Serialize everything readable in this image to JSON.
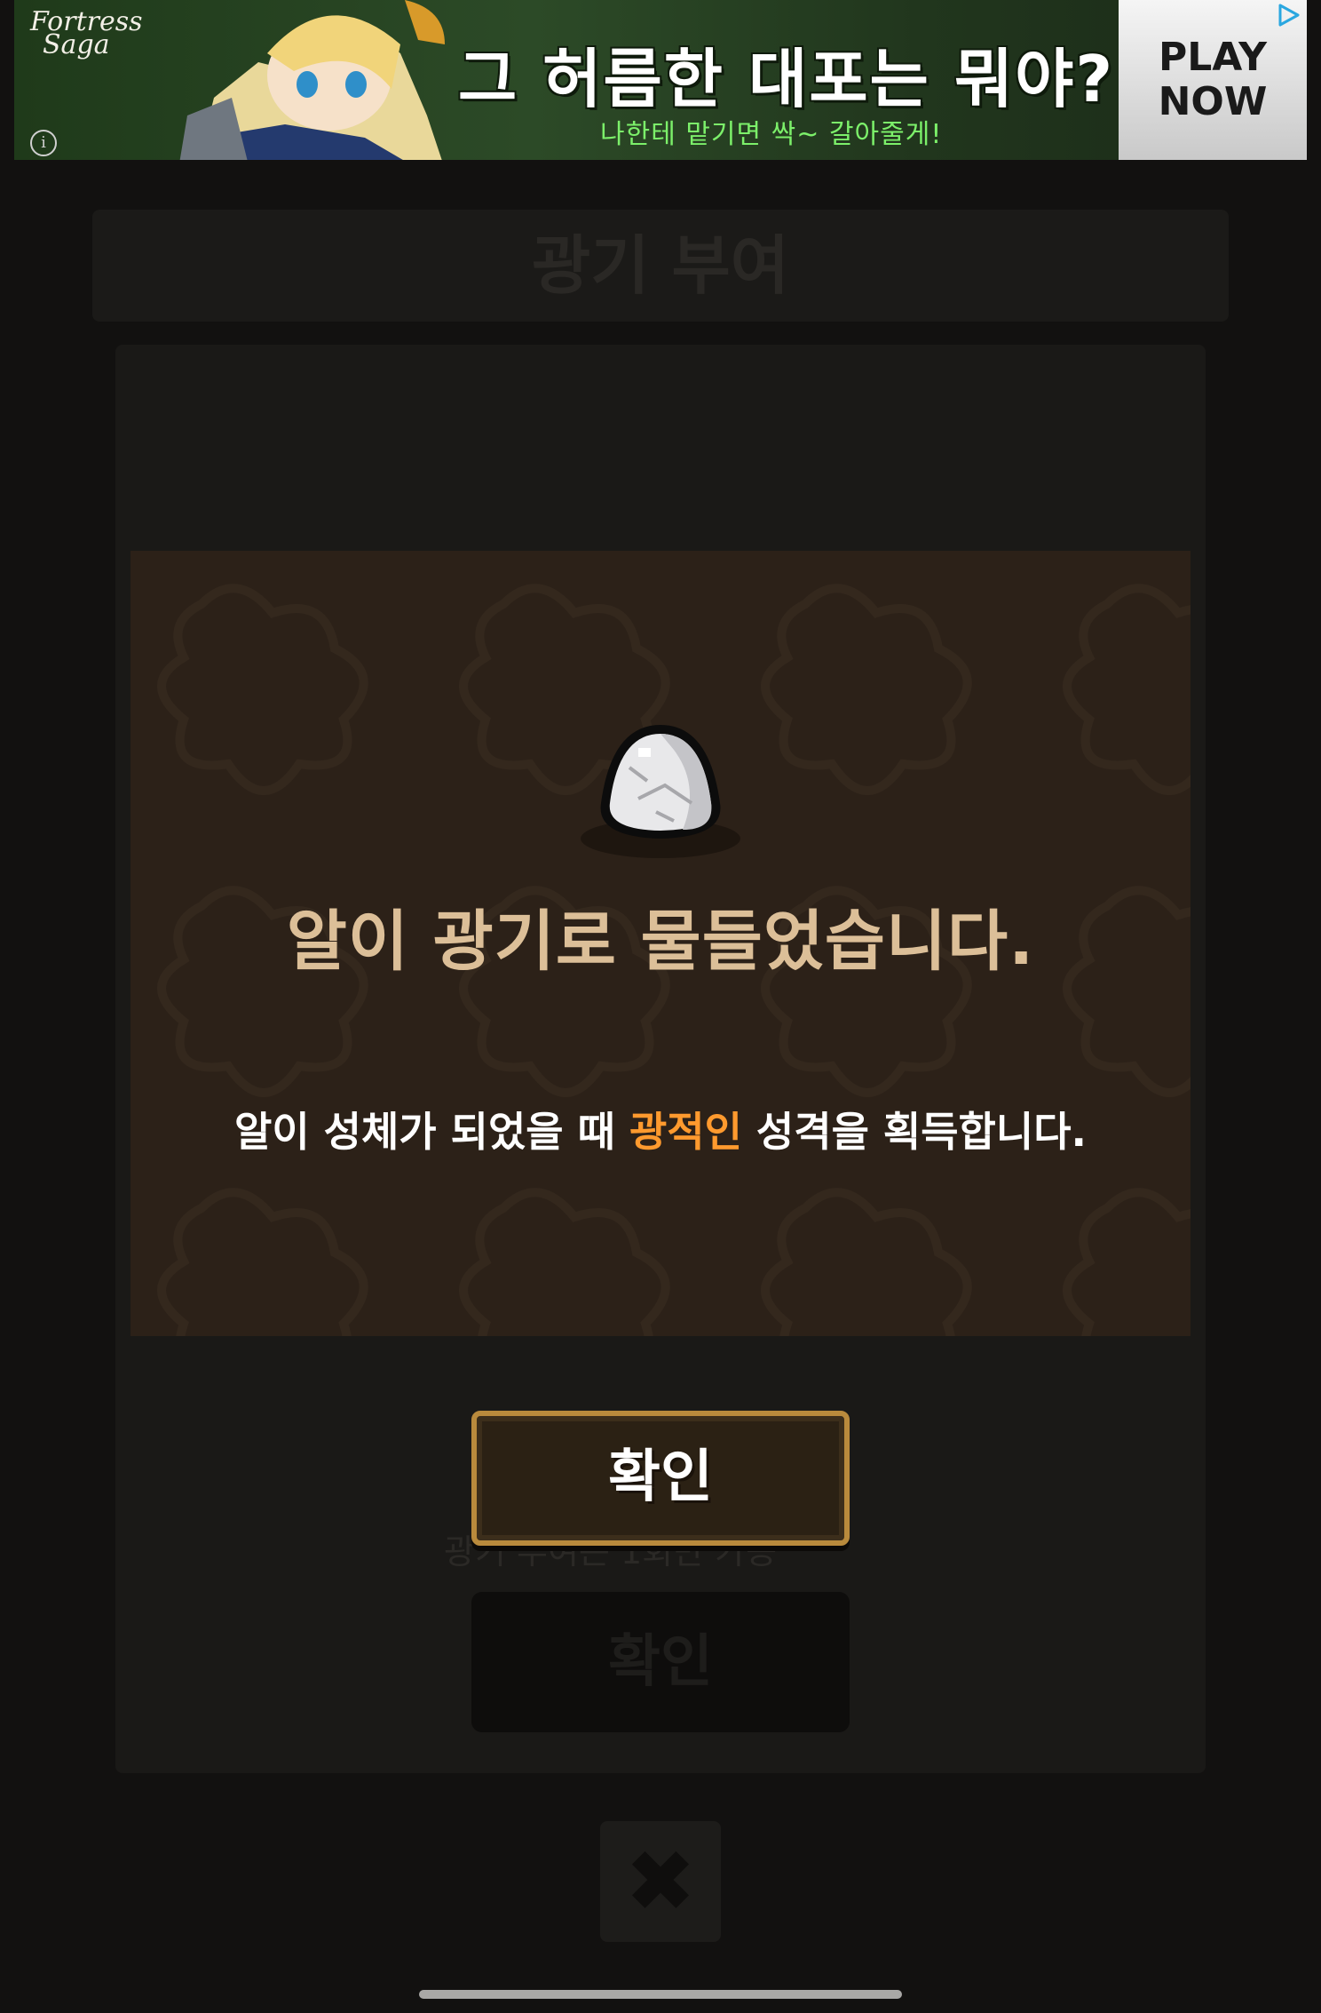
{
  "ad": {
    "logo_line1": "Fortress",
    "logo_line2": "Saga",
    "headline": "그 허름한 대포는 뭐야?",
    "subline": "나한테 맡기면 싹~ 갈아줄게!",
    "cta_line1": "PLAY",
    "cta_line2": "NOW",
    "info_glyph": "i"
  },
  "background_screen": {
    "title": "광기 부여",
    "caption": "광기 부여는 1회만 가능",
    "button_label": "확인",
    "close_glyph": "✖"
  },
  "modal": {
    "title": "알이 광기로 물들었습니다.",
    "desc_before": "알이 성체가 되었을 때 ",
    "desc_highlight": "광적인",
    "desc_after": " 성격을 획득합니다.",
    "highlight_color": "#ff9a2e",
    "title_color": "#dcbf98",
    "confirm_label": "확인"
  }
}
